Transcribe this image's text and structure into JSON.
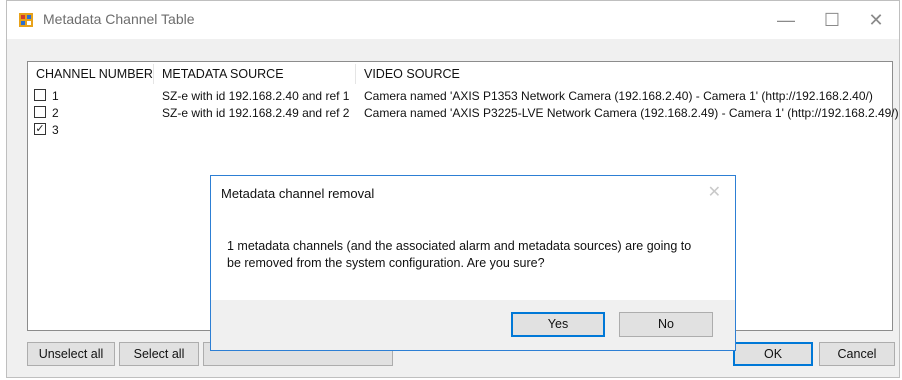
{
  "window": {
    "title": "Metadata Channel Table",
    "controls": {
      "minimize": "—",
      "maximize": "☐",
      "close": "✕"
    }
  },
  "table": {
    "columns": [
      "CHANNEL NUMBER",
      "METADATA SOURCE",
      "VIDEO SOURCE"
    ],
    "rows": [
      {
        "checked": false,
        "channel": "1",
        "metadata_source": "SZ-e with id 192.168.2.40 and ref 1",
        "video_source": "Camera named 'AXIS P1353 Network Camera (192.168.2.40) - Camera 1' (http://192.168.2.40/)"
      },
      {
        "checked": false,
        "channel": "2",
        "metadata_source": "SZ-e with id 192.168.2.49 and ref 2",
        "video_source": "Camera named 'AXIS P3225-LVE Network Camera (192.168.2.49) - Camera 1' (http://192.168.2.49/)"
      },
      {
        "checked": true,
        "channel": "3",
        "metadata_source": "",
        "video_source": ""
      }
    ]
  },
  "buttons": {
    "unselect_all": "Unselect all",
    "select_all": "Select all",
    "ok": "OK",
    "cancel": "Cancel"
  },
  "dialog": {
    "title": "Metadata channel removal",
    "close_glyph": "✕",
    "message": "1 metadata channels (and the associated alarm and metadata sources) are going to be removed from the system configuration. Are you sure?",
    "yes": "Yes",
    "no": "No"
  },
  "colors": {
    "accent": "#0078d7",
    "dialog_border": "#2d7fd4"
  }
}
